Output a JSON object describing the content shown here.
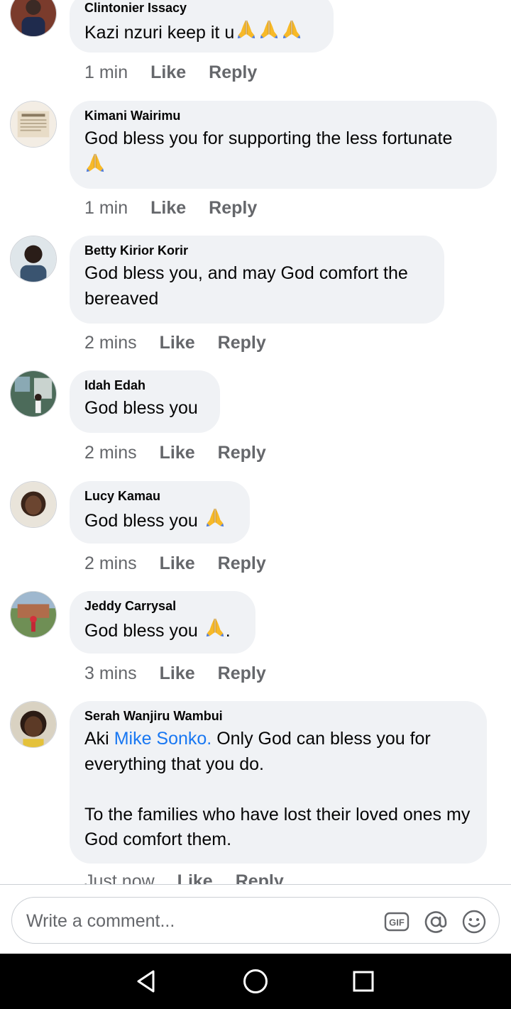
{
  "comments": [
    {
      "author": "Clintonier Issacy",
      "text": "Kazi nzuri keep it u",
      "emoji_count": 3,
      "time": "1 min",
      "like": "Like",
      "reply": "Reply"
    },
    {
      "author": "Kimani Wairimu",
      "text": "God bless you for supporting the less fortunate",
      "emoji_count": 1,
      "time": "1 min",
      "like": "Like",
      "reply": "Reply"
    },
    {
      "author": "Betty Kirior Korir",
      "text": "God bless you, and may God comfort the bereaved",
      "time": "2 mins",
      "like": "Like",
      "reply": "Reply"
    },
    {
      "author": "Idah Edah",
      "text": "God bless you",
      "time": "2 mins",
      "like": "Like",
      "reply": "Reply"
    },
    {
      "author": "Lucy Kamau",
      "text": "God bless you",
      "emoji_count": 1,
      "time": "2 mins",
      "like": "Like",
      "reply": "Reply"
    },
    {
      "author": "Jeddy Carrysal",
      "text": "God bless you",
      "emoji_count": 1,
      "trailing": ".",
      "time": "3 mins",
      "like": "Like",
      "reply": "Reply"
    },
    {
      "author": "Serah Wanjiru Wambui",
      "text_prefix": "Aki",
      "mention": "Mike Sonko.",
      "text_rest": "Only God can bless you for everything that you do.",
      "text_paragraph2": "To the families who have lost their loved ones my God comfort them.",
      "time": "Just now",
      "like": "Like",
      "reply": "Reply"
    }
  ],
  "composer": {
    "placeholder": "Write a comment...",
    "icons": [
      "gif-icon",
      "mention-icon",
      "emoji-icon"
    ]
  },
  "nav": {
    "icons": [
      "back-icon",
      "home-icon",
      "recents-icon"
    ]
  },
  "colors": {
    "bubble": "#f0f2f5",
    "meta": "#65676b",
    "mention": "#1877f2",
    "emoji": "#f7b928"
  }
}
